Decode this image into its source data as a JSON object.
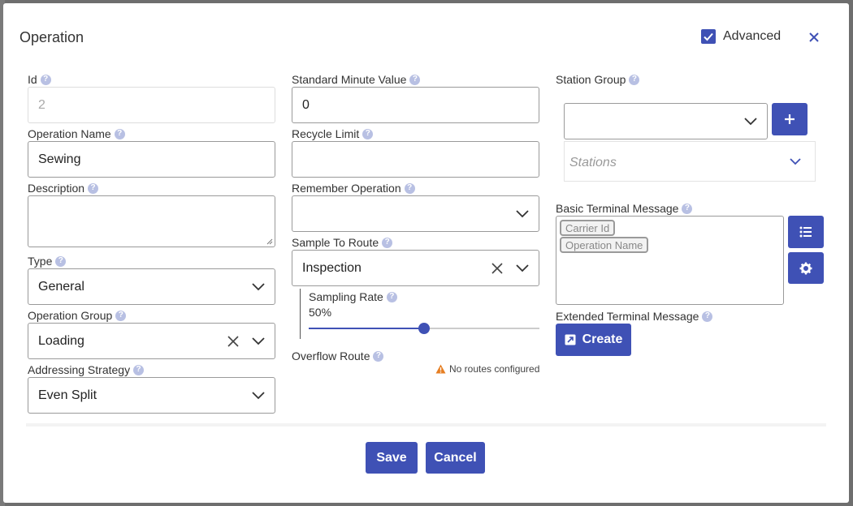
{
  "dialog": {
    "title": "Operation",
    "advanced_label": "Advanced",
    "advanced_checked": true
  },
  "fields": {
    "id": {
      "label": "Id",
      "value": "2"
    },
    "operation_name": {
      "label": "Operation Name",
      "value": "Sewing"
    },
    "description": {
      "label": "Description",
      "value": ""
    },
    "type": {
      "label": "Type",
      "value": "General"
    },
    "operation_group": {
      "label": "Operation Group",
      "value": "Loading"
    },
    "addressing_strategy": {
      "label": "Addressing Strategy",
      "value": "Even Split"
    },
    "standard_minute_value": {
      "label": "Standard Minute Value",
      "value": "0"
    },
    "recycle_limit": {
      "label": "Recycle Limit",
      "value": ""
    },
    "remember_operation": {
      "label": "Remember Operation",
      "value": ""
    },
    "sample_to_route": {
      "label": "Sample To Route",
      "value": "Inspection"
    },
    "sampling_rate": {
      "label": "Sampling Rate",
      "value": "50%",
      "fraction": 0.5
    },
    "overflow_route": {
      "label": "Overflow Route",
      "warning": "No routes configured"
    },
    "station_group": {
      "label": "Station Group",
      "value": "",
      "stations_placeholder": "Stations"
    },
    "basic_terminal_message": {
      "label": "Basic Terminal Message",
      "chips": [
        "Carrier Id",
        "Operation Name"
      ]
    },
    "extended_terminal_message": {
      "label": "Extended Terminal Message",
      "create_label": "Create"
    }
  },
  "footer": {
    "save_label": "Save",
    "cancel_label": "Cancel"
  },
  "help_glyph": "?",
  "colors": {
    "accent": "#3f51b5",
    "help": "#b8c0e3",
    "warning": "#e67e22"
  }
}
